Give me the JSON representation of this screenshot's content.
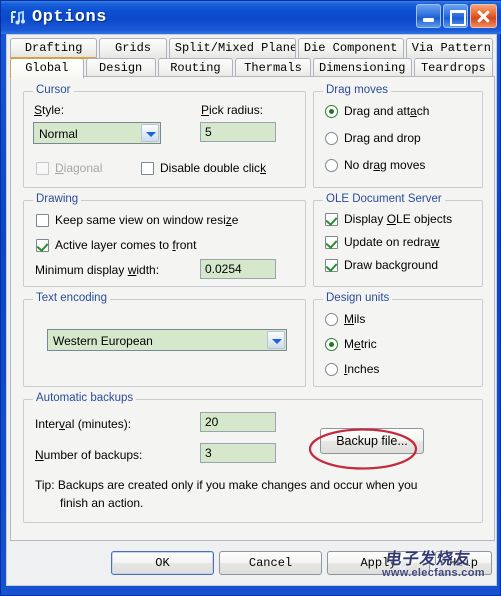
{
  "window": {
    "title": "Options",
    "icon": "app-icon",
    "buttons": {
      "minimize": "minimize-button",
      "maximize": "maximize-button",
      "close": "close-button"
    }
  },
  "tabs": {
    "row1": [
      {
        "label": "Drafting",
        "selected": true
      },
      {
        "label": "Grids",
        "selected": false
      },
      {
        "label": "Split/Mixed Plane",
        "selected": false
      },
      {
        "label": "Die Component",
        "selected": false
      },
      {
        "label": "Via Patterns",
        "selected": false
      }
    ],
    "row2": [
      {
        "label": "Global",
        "selected": true
      },
      {
        "label": "Design",
        "selected": false
      },
      {
        "label": "Routing",
        "selected": false
      },
      {
        "label": "Thermals",
        "selected": false
      },
      {
        "label": "Dimensioning",
        "selected": false
      },
      {
        "label": "Teardrops",
        "selected": false
      }
    ]
  },
  "groups": {
    "cursor": {
      "legend": "Cursor",
      "style_label": "Style:",
      "style_value": "Normal",
      "pick_radius_label": "Pick radius:",
      "pick_radius_value": "5",
      "diagonal_label": "Diagonal",
      "diagonal_checked": false,
      "diagonal_disabled": true,
      "disable_double_click_label": "Disable double click",
      "disable_double_click_checked": false
    },
    "drag_moves": {
      "legend": "Drag moves",
      "options": [
        {
          "label": "Drag and attach",
          "selected": true
        },
        {
          "label": "Drag and drop",
          "selected": false
        },
        {
          "label": "No drag moves",
          "selected": false
        }
      ]
    },
    "drawing": {
      "legend": "Drawing",
      "keep_same_view_label": "Keep same view on window resize",
      "keep_same_view_checked": false,
      "active_layer_label": "Active layer comes to front",
      "active_layer_checked": true,
      "min_display_width_label": "Minimum display width:",
      "min_display_width_value": "0.0254"
    },
    "ole": {
      "legend": "OLE Document Server",
      "options": [
        {
          "label": "Display OLE objects",
          "checked": true
        },
        {
          "label": "Update on redraw",
          "checked": true
        },
        {
          "label": "Draw background",
          "checked": true
        }
      ]
    },
    "text_encoding": {
      "legend": "Text encoding",
      "value": "Western European"
    },
    "design_units": {
      "legend": "Design units",
      "options": [
        {
          "label": "Mils",
          "selected": false
        },
        {
          "label": "Metric",
          "selected": true
        },
        {
          "label": "Inches",
          "selected": false
        }
      ]
    },
    "backups": {
      "legend": "Automatic backups",
      "interval_label": "Interval (minutes):",
      "interval_value": "20",
      "number_label": "Number of backups:",
      "number_value": "3",
      "backup_file_button": "Backup file...",
      "tip_line1": "Tip: Backups are created only if you make changes and occur when you",
      "tip_line2": "finish an action."
    }
  },
  "footer": {
    "ok": "OK",
    "cancel": "Cancel",
    "apply": "Apply",
    "help": "Help"
  },
  "annotation": {
    "type": "red-ellipse-highlight",
    "target": "Metric",
    "color": "#c42a3c"
  },
  "watermark": {
    "text_cn": "电子发烧友",
    "url": "www.elecfans.com"
  },
  "colors": {
    "titlebar": "#0b4fd2",
    "field_green": "#d5e8cc",
    "legend_blue": "#2b4c9b",
    "annotation_red": "#c42a3c"
  }
}
